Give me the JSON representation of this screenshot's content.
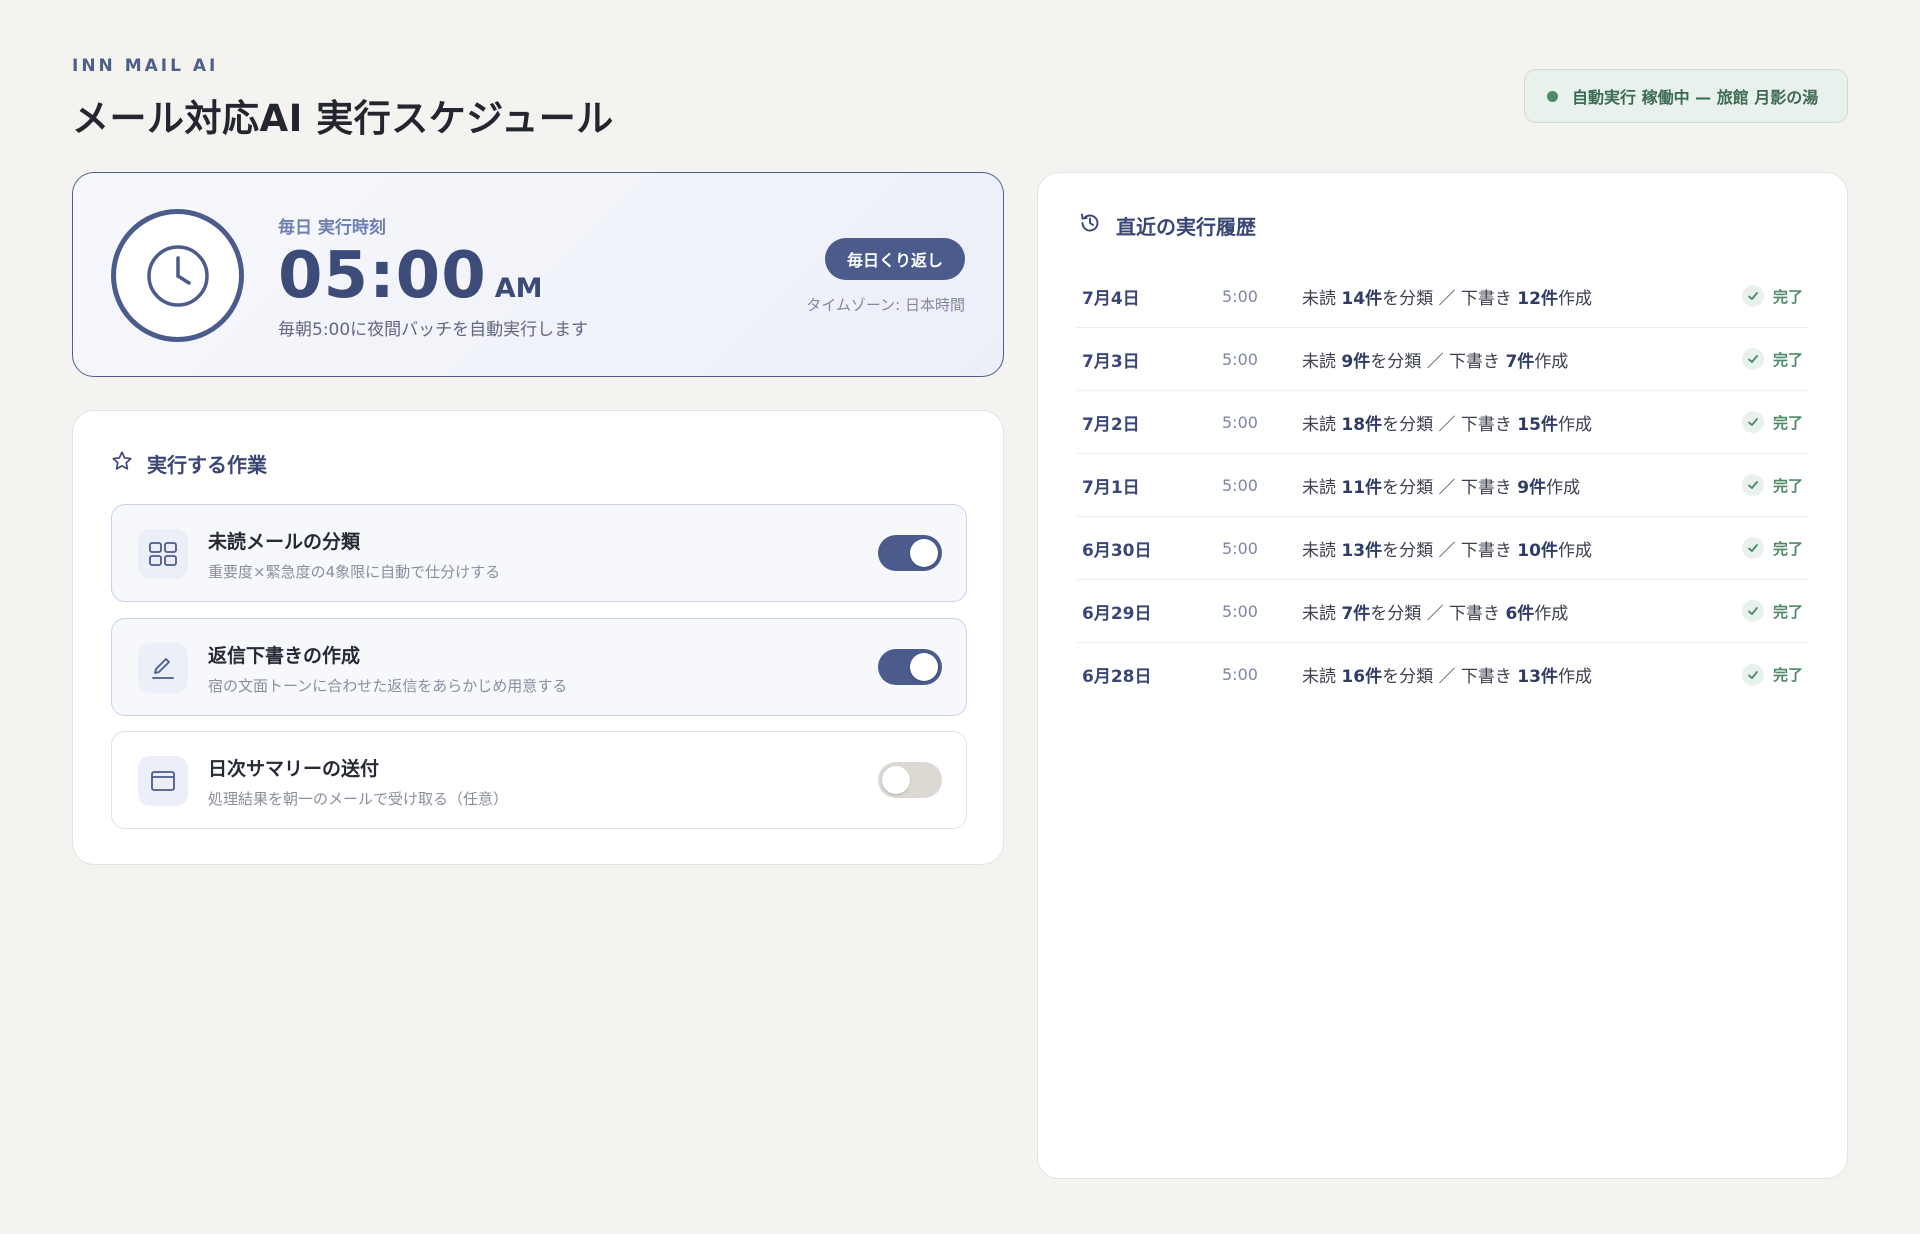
{
  "header": {
    "eyebrow": "INN MAIL AI",
    "title": "メール対応AI 実行スケジュール",
    "status": "自動実行 稼働中 — 旅館 月影の湯"
  },
  "schedule": {
    "label": "毎日 実行時刻",
    "time": "05:00",
    "ampm": "AM",
    "description": "毎朝5:00に夜間バッチを自動実行します",
    "repeat_badge": "毎日くり返し",
    "timezone": "タイムゾーン: 日本時間"
  },
  "tasks": {
    "heading": "実行する作業",
    "items": [
      {
        "title": "未読メールの分類",
        "description": "重要度×緊急度の4象限に自動で仕分けする",
        "enabled": true,
        "icon": "grid-icon"
      },
      {
        "title": "返信下書きの作成",
        "description": "宿の文面トーンに合わせた返信をあらかじめ用意する",
        "enabled": true,
        "icon": "pencil-icon"
      },
      {
        "title": "日次サマリーの送付",
        "description": "処理結果を朝一のメールで受け取る（任意）",
        "enabled": false,
        "icon": "window-icon"
      }
    ]
  },
  "history": {
    "heading": "直近の実行履歴",
    "status_label": "完了",
    "summary_parts": {
      "prefix": "未読 ",
      "classified": "を分類 ／ 下書き ",
      "suffix": "作成"
    },
    "rows": [
      {
        "date": "7月4日",
        "time": "5:00",
        "unread": "14件",
        "drafts": "12件"
      },
      {
        "date": "7月3日",
        "time": "5:00",
        "unread": "9件",
        "drafts": "7件"
      },
      {
        "date": "7月2日",
        "time": "5:00",
        "unread": "18件",
        "drafts": "15件"
      },
      {
        "date": "7月1日",
        "time": "5:00",
        "unread": "11件",
        "drafts": "9件"
      },
      {
        "date": "6月30日",
        "time": "5:00",
        "unread": "13件",
        "drafts": "10件"
      },
      {
        "date": "6月29日",
        "time": "5:00",
        "unread": "7件",
        "drafts": "6件"
      },
      {
        "date": "6月28日",
        "time": "5:00",
        "unread": "16件",
        "drafts": "13件"
      }
    ]
  },
  "colors": {
    "accent": "#4a5b8c",
    "success": "#4f8a66",
    "background": "#f4f3f0"
  }
}
